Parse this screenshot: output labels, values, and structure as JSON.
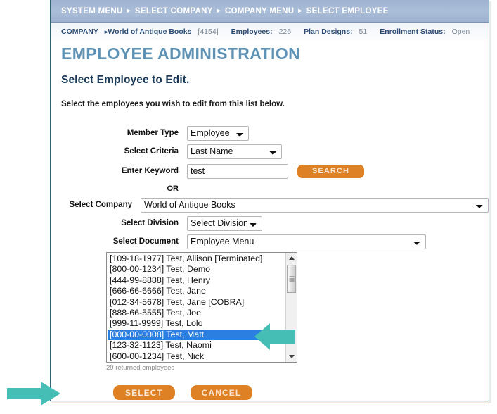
{
  "navbar": {
    "items": [
      "SYSTEM MENU",
      "SELECT COMPANY",
      "COMPANY MENU",
      "SELECT EMPLOYEE"
    ],
    "separator": "▸"
  },
  "breadcrumb": {
    "label": "COMPANY",
    "arrow": "▸",
    "company_name": "World of Antique Books",
    "company_id": "[4154]",
    "employees_label": "Employees:",
    "employees_value": "226",
    "plan_designs_label": "Plan Designs:",
    "plan_designs_value": "51",
    "enrollment_label": "Enrollment Status:",
    "enrollment_value": "Open"
  },
  "page": {
    "title": "EMPLOYEE ADMINISTRATION",
    "subtitle": "Select Employee to Edit.",
    "instruction": "Select the employees you wish to edit from this list below."
  },
  "form": {
    "member_type": {
      "label": "Member Type",
      "value": "Employee",
      "options": [
        "Employee"
      ]
    },
    "select_criteria": {
      "label": "Select Criteria",
      "value": "Last Name",
      "options": [
        "Last Name"
      ]
    },
    "enter_keyword": {
      "label": "Enter Keyword",
      "value": "test",
      "placeholder": ""
    },
    "search_button": "SEARCH",
    "or_label": "OR",
    "select_company": {
      "label": "Select Company",
      "value": "World of Antique Books",
      "options": [
        "World of Antique Books"
      ]
    },
    "select_division": {
      "label": "Select Division",
      "value": "Select Division",
      "options": [
        "Select Division"
      ]
    },
    "select_document": {
      "label": "Select Document",
      "value": "Employee Menu",
      "options": [
        "Employee Menu"
      ]
    }
  },
  "employee_list": {
    "items": [
      {
        "text": "[109-18-1977] Test, Allison [Terminated]",
        "selected": false
      },
      {
        "text": "[800-00-1234] Test, Demo",
        "selected": false
      },
      {
        "text": "[444-99-8888] Test, Henry",
        "selected": false
      },
      {
        "text": "[666-66-6666] Test, Jane",
        "selected": false
      },
      {
        "text": "[012-34-5678] Test, Jane [COBRA]",
        "selected": false
      },
      {
        "text": "[888-66-5555] Test, Joe",
        "selected": false
      },
      {
        "text": "[999-11-9999] Test, Lolo",
        "selected": false
      },
      {
        "text": "[000-00-0008] Test, Matt",
        "selected": true
      },
      {
        "text": "[123-32-1123] Test, Naomi",
        "selected": false
      },
      {
        "text": "[600-00-1234] Test, Nick",
        "selected": false
      }
    ],
    "count_text": "29 returned employees"
  },
  "footer": {
    "select_button": "SELECT",
    "cancel_button": "CANCEL"
  },
  "colors": {
    "nav_blue": "#a5b8d4",
    "title_blue": "#5e93b5",
    "orange": "#dd8124",
    "teal_arrow": "#45beb6",
    "selection_blue": "#2a7fe0",
    "panel_border": "#2d6478"
  }
}
